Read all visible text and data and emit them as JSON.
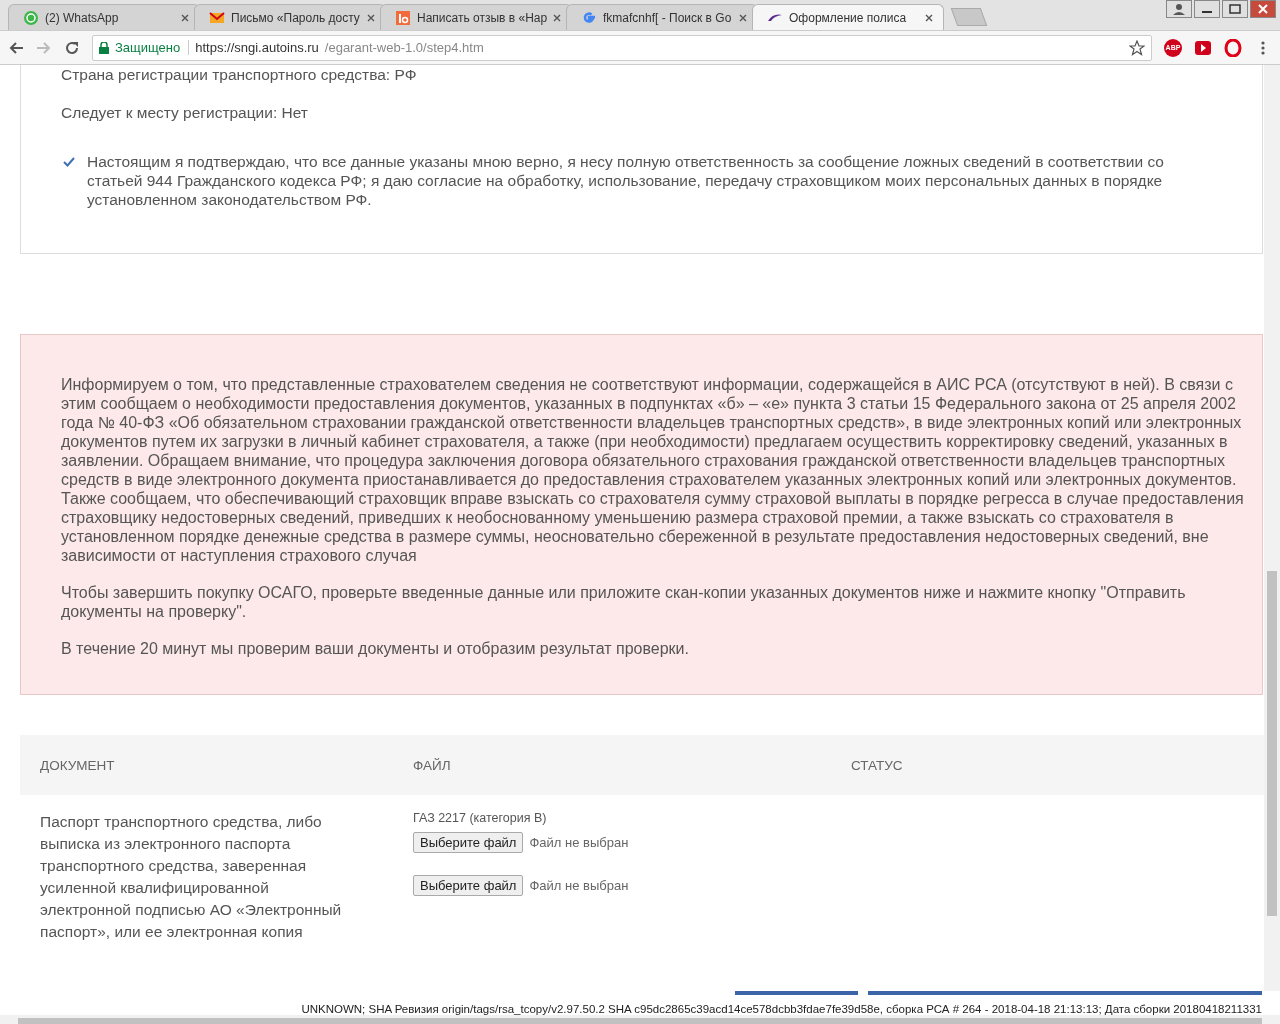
{
  "browser": {
    "tabs": [
      {
        "kind": "whatsapp",
        "title": "(2) WhatsApp",
        "selected": false
      },
      {
        "kind": "mail",
        "title": "Письмо «Пароль досту",
        "selected": false
      },
      {
        "kind": "review",
        "title": "Написать отзыв в «Нар",
        "selected": false
      },
      {
        "kind": "google",
        "title": "fkmafcnhf[ - Поиск в Go",
        "selected": false
      },
      {
        "kind": "site",
        "title": "Оформление полиса",
        "selected": true
      }
    ],
    "security_label": "Защищено",
    "url_host": "https://sngi.autoins.ru",
    "url_path": "/egarant-web-1.0/step4.htm",
    "adblock_label": "ABP"
  },
  "summary": {
    "lines": [
      "Страна регистрации транспортного средства: РФ",
      "Следует к месту регистрации: Нет"
    ],
    "consent": {
      "checked": true,
      "text": "Настоящим я подтверждаю, что все данные указаны мною верно, я несу полную ответственность за сообщение ложных сведений в соответствии со статьей 944 Гражданского кодекса РФ; я даю согласие на обработку, использование, передачу страховщиком моих персональных данных в порядке установленном законодательством РФ."
    }
  },
  "alert": {
    "paragraphs": [
      "Информируем о том, что представленные страхователем сведения не соответствуют информации, содержащейся в АИС РСА (отсутствуют в ней). В связи с этим сообщаем о необходимости предоставления документов, указанных в подпунктах «б» – «е» пункта 3 статьи 15 Федерального закона от 25 апреля 2002 года № 40-ФЗ «Об обязательном страховании гражданской ответственности владельцев транспортных средств», в виде электронных копий или электронных документов путем их загрузки в личный кабинет страхователя, а также (при необходимости) предлагаем осуществить корректировку сведений, указанных в заявлении. Обращаем внимание, что процедура заключения договора обязательного страхования гражданской ответственности владельцев транспортных средств в виде электронного документа приостанавливается до предоставления страхователем указанных электронных копий или электронных документов. Также сообщаем, что обеспечивающий страховщик вправе взыскать со страхователя сумму страховой выплаты в порядке регресса в случае предоставления страховщику недостоверных сведений, приведших к необоснованному уменьшению размера страховой премии, а также взыскать со страхователя в установленном порядке денежные средства в размере суммы, неосновательно сбереженной в результате предоставления недостоверных сведений, вне зависимости от наступления страхового случая",
      "Чтобы завершить покупку ОСАГО, проверьте введенные данные или приложите скан-копии указанных документов ниже и нажмите кнопку \"Отправить документы на проверку\".",
      "В течение 20 минут мы проверим ваши документы и отобразим результат проверки."
    ]
  },
  "documents": {
    "columns": [
      "ДОКУМЕНТ",
      "ФАЙЛ",
      "СТАТУС"
    ],
    "rows": [
      {
        "document": "Паспорт транспортного средства, либо выписка из электронного паспорта транспортного средства, заверенная усиленной квалифицированной электронной подписью АО «Электронный паспорт», или ее электронная копия",
        "vehicle": "ГАЗ 2217 (категория В)",
        "files": [
          {
            "button": "Выберите файл",
            "status": "Файл не выбран"
          },
          {
            "button": "Выберите файл",
            "status": "Файл не выбран"
          }
        ]
      }
    ]
  },
  "build_info": "UNKNOWN; SHA Ревизия origin/tags/rsa_tcopy/v2.97.50.2 SHA c95dc2865c39acd14ce578dcbb3fdae7fe39d58e, сборка РСА # 264 - 2018-04-18 21:13:13; Дата сборки 20180418211331"
}
